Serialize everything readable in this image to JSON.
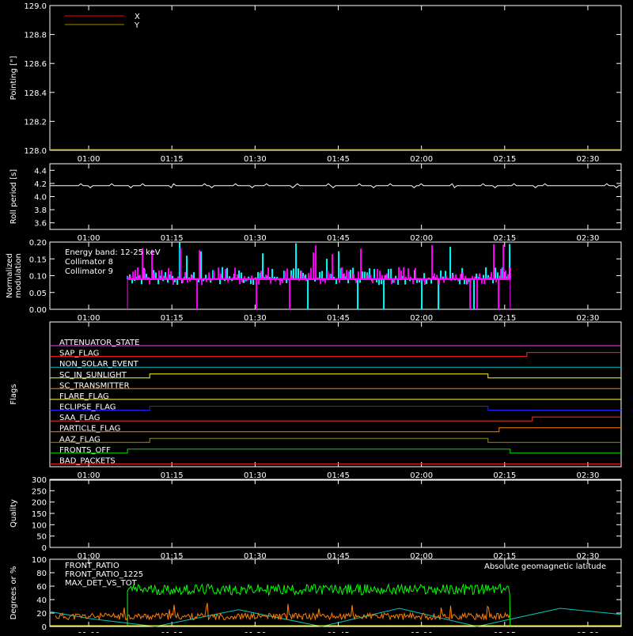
{
  "x_ticks": [
    "01:00",
    "01:15",
    "01:30",
    "01:45",
    "02:00",
    "02:15",
    "02:30"
  ],
  "chart_data": [
    {
      "type": "line",
      "ylabel": "Pointing [\"]",
      "ylim": [
        128.0,
        129.0
      ],
      "y_ticks": [
        "128.0",
        "128.2",
        "128.4",
        "128.6",
        "128.8",
        "129.0"
      ],
      "legend_position": "top-left",
      "series": [
        {
          "name": "X",
          "color": "#ff0000",
          "x": [
            "00:53",
            "02:36"
          ],
          "y": [
            128.0,
            128.0
          ]
        },
        {
          "name": "Y",
          "color": "#9a8a00",
          "x": [
            "00:53",
            "02:36"
          ],
          "y": [
            128.0,
            128.0
          ]
        }
      ]
    },
    {
      "type": "line",
      "ylabel": "Roll period [s]",
      "ylim": [
        3.5,
        4.5
      ],
      "y_ticks": [
        "3.6",
        "3.8",
        "4.0",
        "4.2",
        "4.4"
      ],
      "series": [
        {
          "color": "#ffffff",
          "x": [
            "00:53",
            "01:15",
            "01:30",
            "01:45",
            "02:00",
            "02:15",
            "02:36"
          ],
          "y": [
            4.17,
            4.16,
            4.17,
            4.16,
            4.17,
            4.16,
            4.17
          ]
        }
      ]
    },
    {
      "type": "bar",
      "ylabel": "Normalized modulation",
      "ylim": [
        0.0,
        0.2
      ],
      "y_ticks": [
        "0.00",
        "0.05",
        "0.10",
        "0.15",
        "0.20"
      ],
      "annotation": "Energy band: 12-25 keV",
      "legend_position": "top-left",
      "active_x": [
        "01:07",
        "02:16"
      ],
      "series": [
        {
          "name": "Collimator 8",
          "color": "#00ffff",
          "typical_value": 0.1,
          "peak_value": 0.2
        },
        {
          "name": "Collimator 9",
          "color": "#ff00ff",
          "typical_value": 0.1,
          "peak_value": 0.2
        }
      ]
    },
    {
      "type": "line",
      "ylabel": "Flags",
      "flags": [
        {
          "name": "ATTENUATOR_STATE",
          "color": "#ff40ff",
          "transitions": []
        },
        {
          "name": "SAP_FLAG",
          "color": "#ff2020",
          "transitions": [
            "02:19"
          ]
        },
        {
          "name": "NON_SOLAR_EVENT",
          "color": "#00c8c8",
          "transitions": []
        },
        {
          "name": "SC_IN_SUNLIGHT",
          "color": "#ffff00",
          "transitions": [
            "01:11",
            "02:12"
          ]
        },
        {
          "name": "SC_TRANSMITTER",
          "color": "#ff8000",
          "transitions": []
        },
        {
          "name": "FLARE_FLAG",
          "color": "#ffff60",
          "transitions": []
        },
        {
          "name": "ECLIPSE_FLAG",
          "color": "#2020ff",
          "transitions": [
            "01:11",
            "02:12"
          ]
        },
        {
          "name": "SAA_FLAG",
          "color": "#ff3030",
          "transitions": [
            "02:20"
          ]
        },
        {
          "name": "PARTICLE_FLAG",
          "color": "#ff8000",
          "transitions": [
            "02:14"
          ]
        },
        {
          "name": "AAZ_FLAG",
          "color": "#909020",
          "transitions": [
            "01:11",
            "02:12"
          ]
        },
        {
          "name": "FRONTS_OFF",
          "color": "#00e000",
          "transitions": [
            "01:07",
            "02:16"
          ]
        },
        {
          "name": "BAD_PACKETS",
          "color": "#ff2020",
          "transitions": []
        }
      ]
    },
    {
      "type": "line",
      "ylabel": "Quality",
      "ylim": [
        0,
        300
      ],
      "y_ticks": [
        "0",
        "50",
        "100",
        "150",
        "200",
        "250",
        "300"
      ],
      "series": []
    },
    {
      "type": "line",
      "ylabel": "Degrees or %",
      "ylim": [
        0,
        100
      ],
      "y_ticks": [
        "0",
        "20",
        "40",
        "60",
        "80",
        "100"
      ],
      "annotation": "Absolute geomagnetic latitude",
      "legend_position": "top-left",
      "series": [
        {
          "name": "FRONT_RATIO",
          "color": "#ffff00",
          "typical_value": 0
        },
        {
          "name": "FRONT_RATIO_1225",
          "color": "#00ff00",
          "typical_value": 55,
          "active_x": [
            "01:07",
            "02:16"
          ]
        },
        {
          "name": "MAX_DET_VS_TOT",
          "color": "#ff8000",
          "typical_value": 15,
          "active_x": [
            "00:54",
            "02:16"
          ]
        },
        {
          "name": "Absolute geomagnetic latitude",
          "color": "#00c8c8",
          "x": [
            "00:53",
            "01:00",
            "01:12",
            "01:27",
            "01:42",
            "01:56",
            "02:10",
            "02:25",
            "02:36"
          ],
          "y": [
            22,
            12,
            0,
            25,
            0,
            27,
            0,
            27,
            18
          ]
        }
      ]
    }
  ]
}
